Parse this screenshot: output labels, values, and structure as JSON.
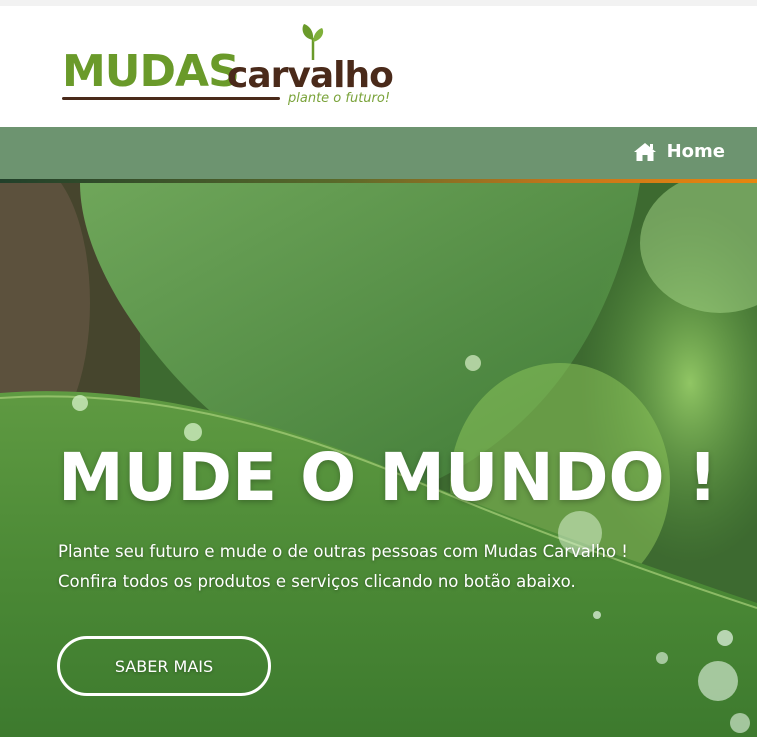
{
  "logo": {
    "brand_primary": "MUDAS",
    "brand_secondary": "carvalho",
    "tagline": "plante o futuro!",
    "colors": {
      "green": "#6a9a2a",
      "brown": "#4a2a1a"
    }
  },
  "nav": {
    "items": [
      {
        "label": "Home",
        "icon": "home-icon"
      }
    ],
    "background": "#6d9470"
  },
  "hero": {
    "title": "MUDE O MUNDO !",
    "line1": "Plante seu futuro e mude o de outras pessoas com Mudas Carvalho !",
    "line2": "Confira todos os produtos e serviços clicando no botão abaixo.",
    "button_label": "SABER MAIS"
  }
}
